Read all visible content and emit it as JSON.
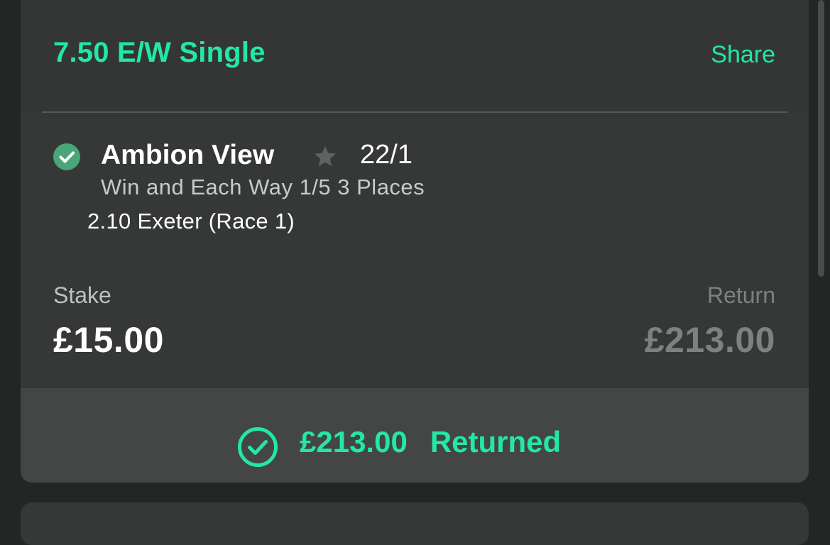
{
  "bet": {
    "title": "7.50 E/W Single",
    "share_label": "Share"
  },
  "selection": {
    "status_icon": "check-circle-icon",
    "horse_name": "Ambion View",
    "favourite_icon": "star-icon",
    "odds": "22/1",
    "market": "Win and Each Way 1/5 3 Places",
    "event": "2.10 Exeter (Race 1)"
  },
  "stake": {
    "label": "Stake",
    "value": "£15.00"
  },
  "return": {
    "label": "Return",
    "value": "£213.00"
  },
  "result": {
    "icon": "check-circle-outline-icon",
    "amount": "£213.00",
    "label": "Returned"
  },
  "colors": {
    "accent": "#23e7a6",
    "background": "#242625",
    "card": "#353836",
    "result_bar": "#434644",
    "won_check": "#4aa57a",
    "muted_text": "#7e817f"
  }
}
